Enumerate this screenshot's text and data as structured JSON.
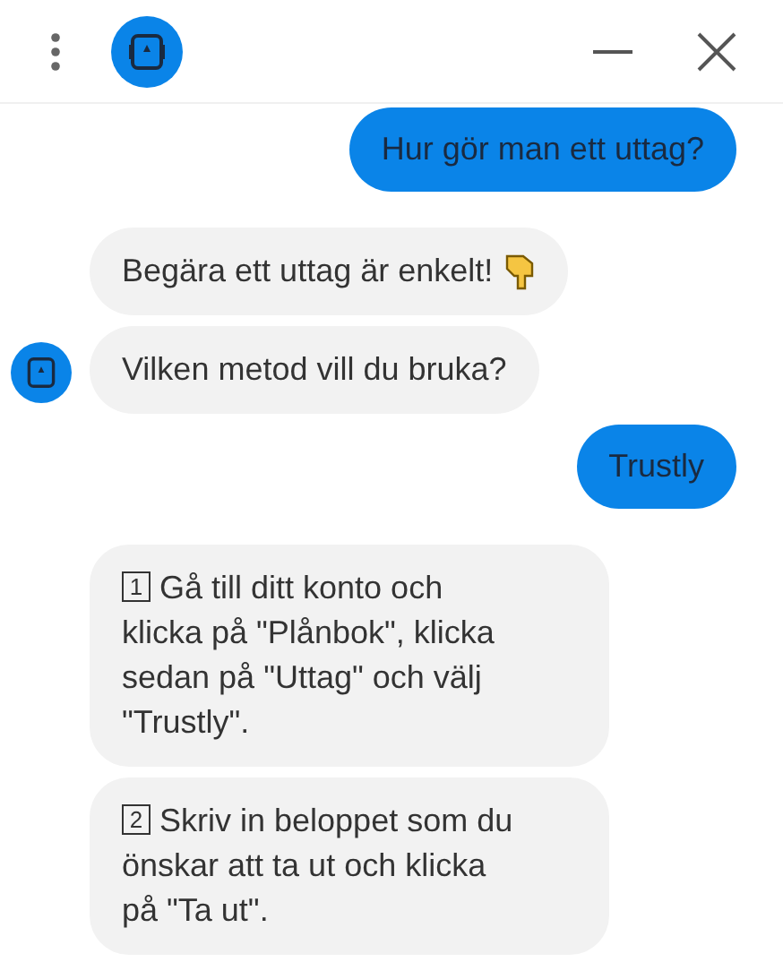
{
  "messages": [
    {
      "kind": "user",
      "text": "Hur gör man ett uttag?"
    },
    {
      "kind": "bot-emoji",
      "text": "Begära ett uttag är enkelt!",
      "avatar": false
    },
    {
      "kind": "bot",
      "text": "Vilken metod vill du bruka?",
      "avatar": true
    },
    {
      "kind": "user",
      "text": "Trustly"
    },
    {
      "kind": "step",
      "number": "1",
      "text": "Gå till ditt konto och klicka på \"Plånbok\", klicka sedan på \"Uttag\" och välj \"Trustly\"."
    },
    {
      "kind": "step",
      "number": "2",
      "text": "Skriv in beloppet som du önskar att ta ut och klicka på \"Ta ut\"."
    }
  ]
}
